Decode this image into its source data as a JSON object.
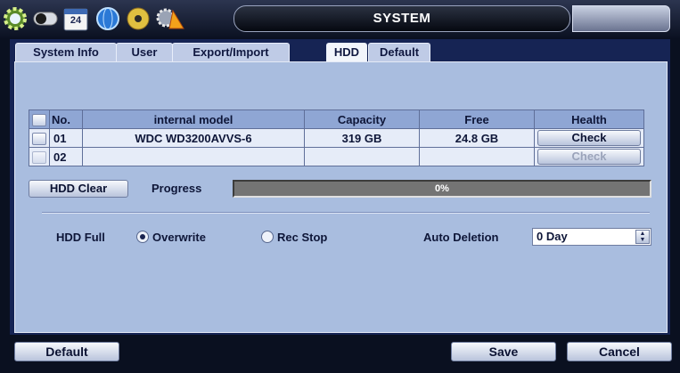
{
  "window": {
    "title": "SYSTEM",
    "toolbar_icons": [
      "gear-icon",
      "toggle-icon",
      "calendar-icon",
      "globe-icon",
      "disc-icon",
      "warning-gear-icon"
    ],
    "calendar_day": "24"
  },
  "tabs": [
    {
      "label": "System Info",
      "active": false
    },
    {
      "label": "User",
      "active": false
    },
    {
      "label": "Export/Import",
      "active": false
    },
    {
      "label": "HDD",
      "active": true
    },
    {
      "label": "Default",
      "active": false
    }
  ],
  "table": {
    "headers": [
      "No.",
      "internal model",
      "Capacity",
      "Free",
      "Health"
    ],
    "rows": [
      {
        "no": "01",
        "model": "WDC WD3200AVVS-6",
        "capacity": "319 GB",
        "free": "24.8 GB",
        "health": "Check",
        "enabled": true
      },
      {
        "no": "02",
        "model": "",
        "capacity": "",
        "free": "",
        "health": "Check",
        "enabled": false
      }
    ]
  },
  "hdd_clear": {
    "button": "HDD Clear",
    "progress_label": "Progress",
    "progress_text": "0%",
    "progress_value": 0
  },
  "hdd_full": {
    "label": "HDD Full",
    "option_overwrite": "Overwrite",
    "option_rec_stop": "Rec Stop",
    "selected": "Overwrite"
  },
  "auto_deletion": {
    "label": "Auto Deletion",
    "value": "0 Day"
  },
  "footer": {
    "default_label": "Default",
    "save_label": "Save",
    "cancel_label": "Cancel"
  }
}
